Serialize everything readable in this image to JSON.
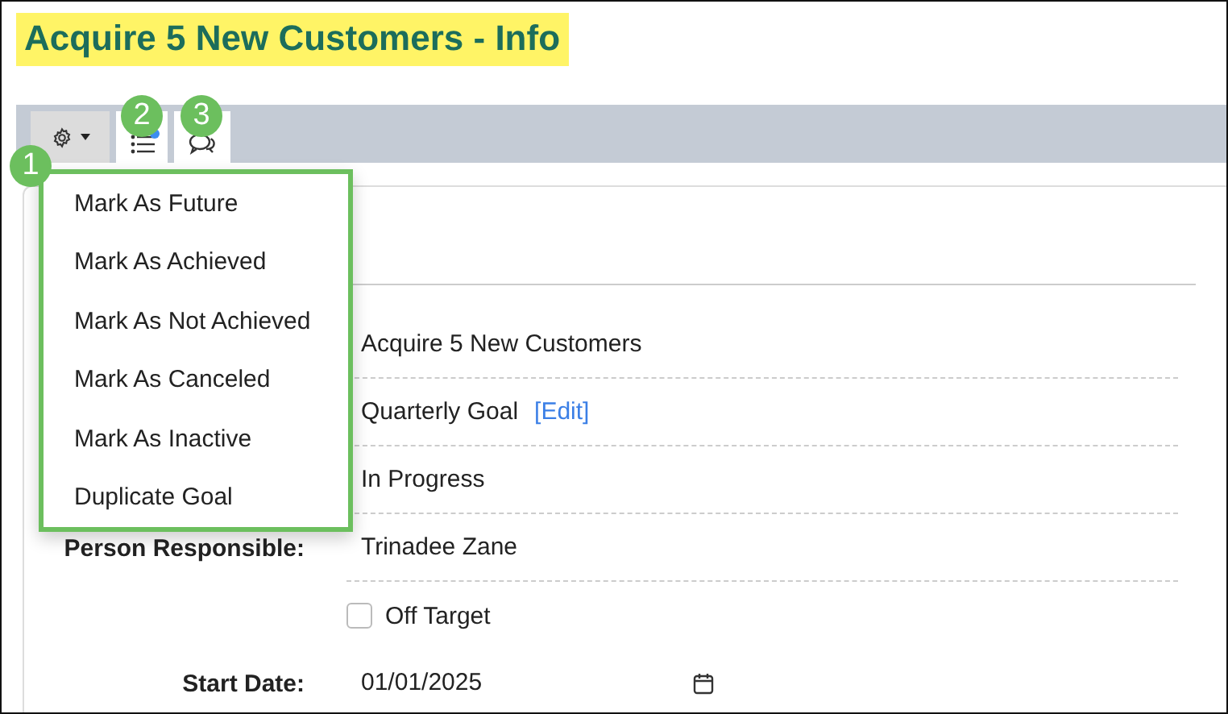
{
  "title": "Acquire 5 New Customers - Info",
  "toolbar": {
    "buttons": [
      {
        "kind": "gear",
        "has_dot": false
      },
      {
        "kind": "list",
        "has_dot": true
      },
      {
        "kind": "chat",
        "has_dot": false
      }
    ]
  },
  "menu": {
    "items": [
      "Mark As Future",
      "Mark As Achieved",
      "Mark As Not Achieved",
      "Mark As Canceled",
      "Mark As Inactive",
      "Duplicate Goal"
    ]
  },
  "callouts": [
    "1",
    "2",
    "3"
  ],
  "form": {
    "rows": [
      {
        "kind": "text",
        "value": "Acquire 5 New Customers"
      },
      {
        "kind": "text",
        "value": "Quarterly Goal",
        "link": "[Edit]"
      },
      {
        "kind": "text",
        "value": "In Progress"
      },
      {
        "kind": "text",
        "label": "Person Responsible:",
        "value": "Trinadee Zane"
      },
      {
        "kind": "checkbox",
        "value": "Off Target",
        "checked": false
      },
      {
        "kind": "date",
        "label": "Start Date:",
        "value": "01/01/2025"
      }
    ]
  }
}
